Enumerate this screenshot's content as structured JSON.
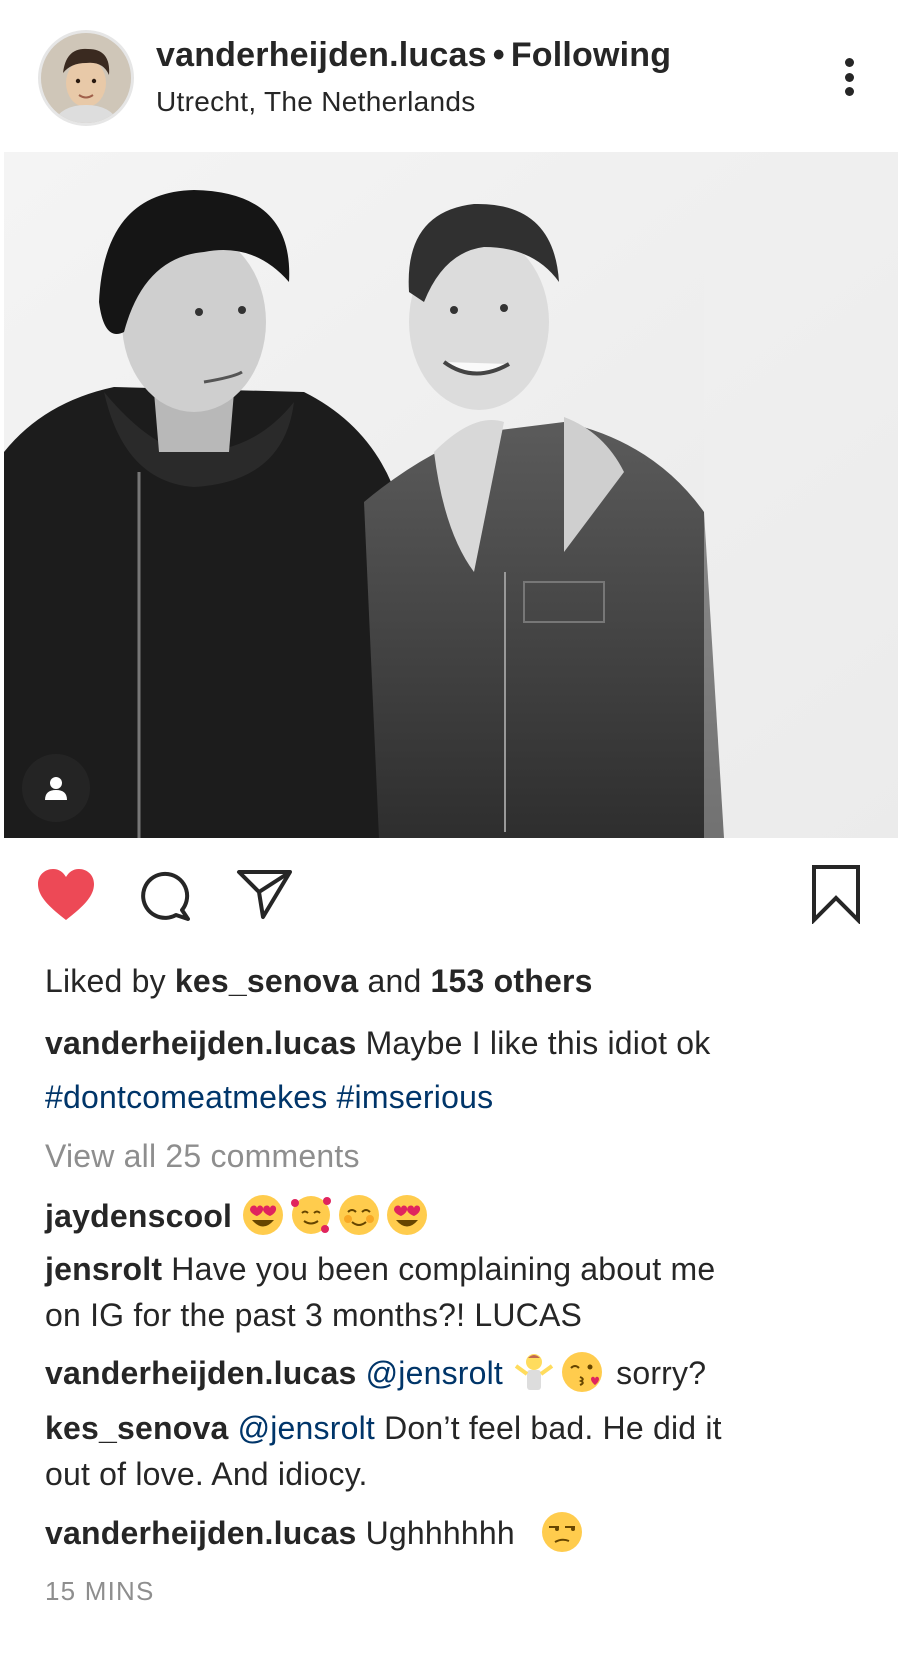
{
  "header": {
    "username": "vanderheijden.lucas",
    "separator": "•",
    "follow_status": "Following",
    "location": "Utrecht, The Netherlands"
  },
  "icons": {
    "more": "more-vertical-icon",
    "like": "heart-icon",
    "comment": "comment-icon",
    "share": "send-icon",
    "save": "bookmark-icon",
    "tag": "person-icon"
  },
  "colors": {
    "like_active": "#ed4956",
    "hashtag": "#003569",
    "muted": "#8e8e8e",
    "text": "#262626"
  },
  "likes": {
    "prefix": "Liked by",
    "user": "kes_senova",
    "middle": "and",
    "others": "153 others"
  },
  "caption": {
    "user": "vanderheijden.lucas",
    "text": "Maybe I like this idiot ok",
    "hashtags": "#dontcomeatmekes #imserious"
  },
  "view_all_comments": "View all 25 comments",
  "comments": [
    {
      "user": "jaydenscool",
      "text": "😍🥰☺️😍"
    },
    {
      "user": "jensrolt",
      "text_line1": "Have you been complaining about me",
      "text_line2": "on IG for the past 3 months?! LUCAS"
    },
    {
      "user": "vanderheijden.lucas",
      "mention": "@jensrolt",
      "text": "🤷‍♂️😘 sorry?",
      "text_after": "sorry?"
    },
    {
      "user": "kes_senova",
      "mention": "@jensrolt",
      "text_line1": "Don’t feel bad. He did it",
      "text_line2": "out of love. And idiocy."
    },
    {
      "user": "vanderheijden.lucas",
      "text": "Ughhhhhh 😒",
      "text_plain": "Ughhhhhh"
    }
  ],
  "timestamp": "15 MINS"
}
